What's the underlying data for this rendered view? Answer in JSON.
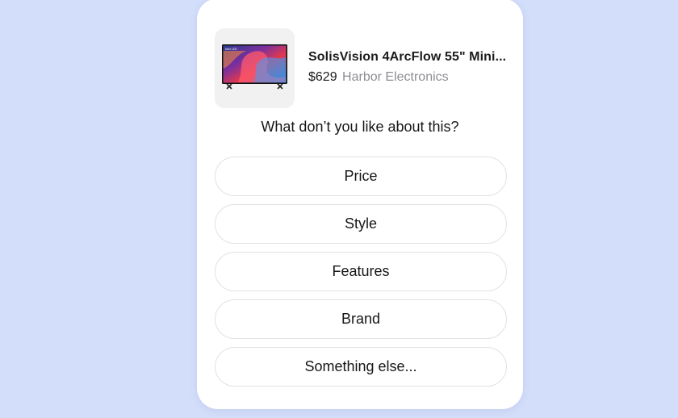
{
  "product": {
    "name": "SolisVision 4ArcFlow 55\" Mini...",
    "price": "$629",
    "seller": "Harbor Electronics",
    "thumbnail_badge": "Mini LED",
    "thumbnail_icon": "tv-image"
  },
  "question": "What don’t you like about this?",
  "options": [
    {
      "label": "Price"
    },
    {
      "label": "Style"
    },
    {
      "label": "Features"
    },
    {
      "label": "Brand"
    },
    {
      "label": "Something else..."
    }
  ],
  "colors": {
    "background": "#d3defa",
    "card": "#ffffff",
    "option_border": "#e2e2e2",
    "seller_text": "#8e8e93"
  }
}
